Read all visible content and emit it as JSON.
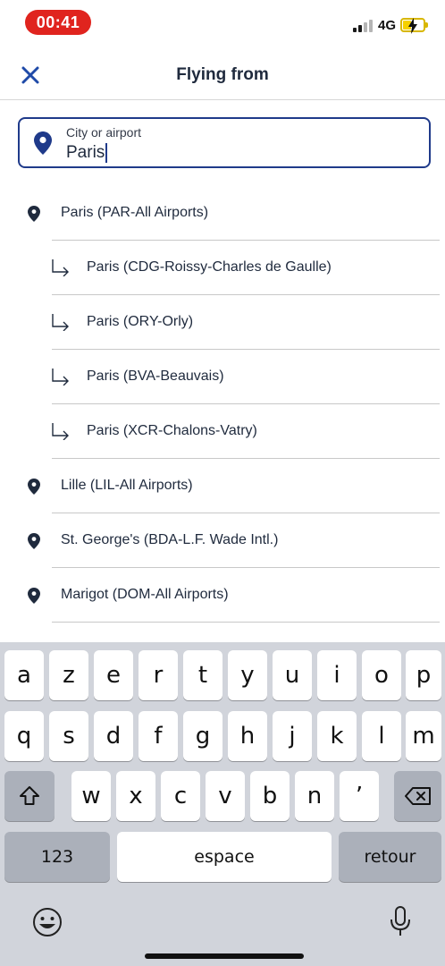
{
  "status_bar": {
    "time": "00:41",
    "network": "4G",
    "battery_level": 0.3,
    "time_pill_color": "#e0241e"
  },
  "header": {
    "title": "Flying from",
    "close_icon": "close-icon"
  },
  "search": {
    "label": "City or airport",
    "value": "Paris",
    "border_color": "#1f3a8a"
  },
  "results": [
    {
      "label": "Paris (PAR-All Airports)",
      "kind": "city"
    },
    {
      "label": "Paris (CDG-Roissy-Charles de Gaulle)",
      "kind": "airport"
    },
    {
      "label": "Paris (ORY-Orly)",
      "kind": "airport"
    },
    {
      "label": "Paris (BVA-Beauvais)",
      "kind": "airport"
    },
    {
      "label": "Paris (XCR-Chalons-Vatry)",
      "kind": "airport"
    },
    {
      "label": "Lille (LIL-All Airports)",
      "kind": "city"
    },
    {
      "label": "St. George's (BDA-L.F. Wade Intl.)",
      "kind": "city"
    },
    {
      "label": "Marigot (DOM-All Airports)",
      "kind": "city"
    }
  ],
  "keyboard": {
    "row1": [
      "a",
      "z",
      "e",
      "r",
      "t",
      "y",
      "u",
      "i",
      "o",
      "p"
    ],
    "row2": [
      "q",
      "s",
      "d",
      "f",
      "g",
      "h",
      "j",
      "k",
      "l",
      "m"
    ],
    "row3": [
      "w",
      "x",
      "c",
      "v",
      "b",
      "n",
      "’"
    ],
    "numbers_label": "123",
    "space_label": "espace",
    "return_label": "retour"
  }
}
